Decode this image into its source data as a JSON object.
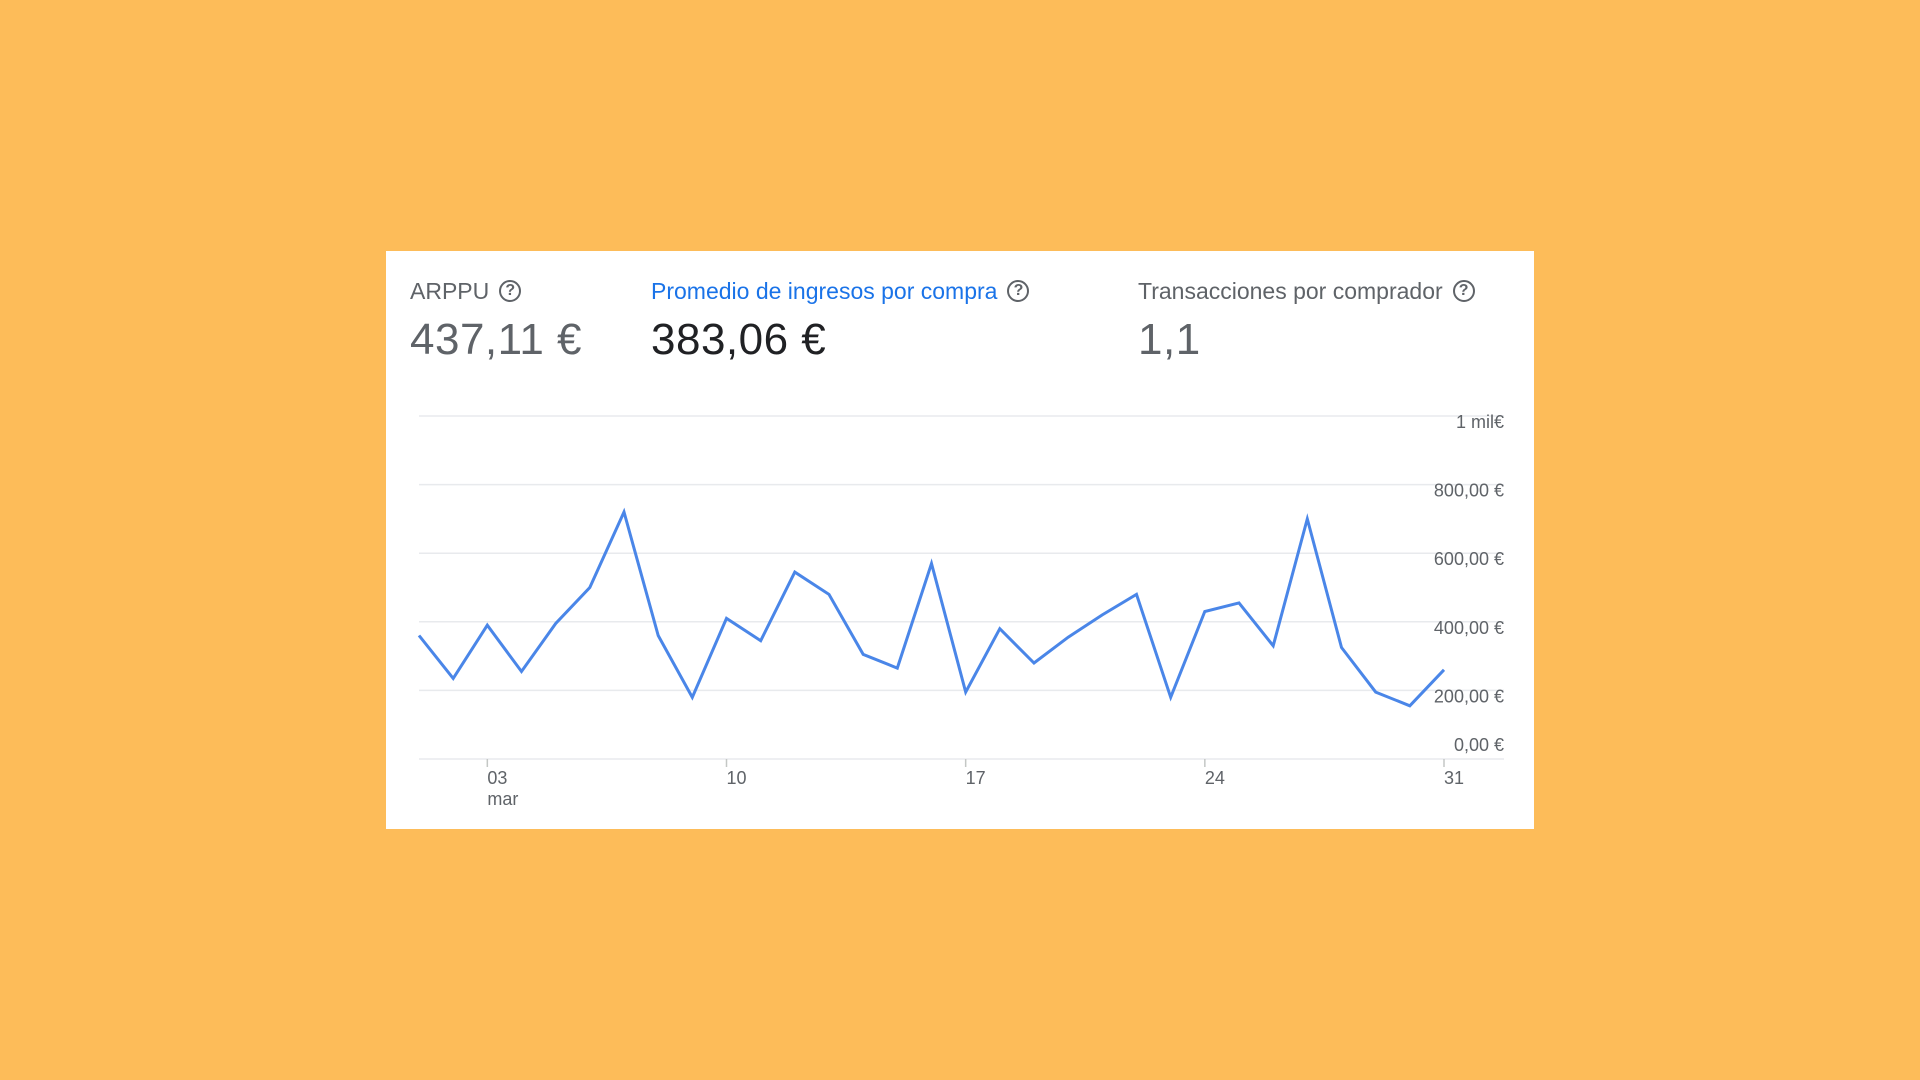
{
  "metrics": [
    {
      "label": "ARPPU",
      "value": "437,11 €",
      "active": false
    },
    {
      "label": "Promedio de ingresos por compra",
      "value": "383,06 €",
      "active": true
    },
    {
      "label": "Transacciones por comprador",
      "value": "1,1",
      "active": false
    }
  ],
  "help_icon": "help-circle-icon",
  "help_glyph": "?",
  "colors": {
    "background": "#FDBC59",
    "line": "#4A86E8",
    "active_label": "#1a73e8",
    "grid": "#e8eaed"
  },
  "chart_data": {
    "type": "line",
    "title": "",
    "xlabel": "",
    "ylabel": "",
    "ylim": [
      0,
      1000
    ],
    "yticks": [
      {
        "value": 1000,
        "label": "1 mil€"
      },
      {
        "value": 800,
        "label": "800,00 €"
      },
      {
        "value": 600,
        "label": "600,00 €"
      },
      {
        "value": 400,
        "label": "400,00 €"
      },
      {
        "value": 200,
        "label": "200,00 €"
      },
      {
        "value": 0,
        "label": "0,00 €"
      }
    ],
    "xticks": [
      {
        "day": 3,
        "label": "03",
        "sublabel": "mar"
      },
      {
        "day": 10,
        "label": "10",
        "sublabel": ""
      },
      {
        "day": 17,
        "label": "17",
        "sublabel": ""
      },
      {
        "day": 24,
        "label": "24",
        "sublabel": ""
      },
      {
        "day": 31,
        "label": "31",
        "sublabel": ""
      }
    ],
    "grid": true,
    "series": [
      {
        "x": [
          1,
          2,
          3,
          4,
          5,
          6,
          7,
          8,
          9,
          10,
          11,
          12,
          13,
          14,
          15,
          16,
          17,
          18,
          19,
          20,
          21,
          22,
          23,
          24,
          25,
          26,
          27,
          28,
          29,
          30,
          31
        ],
        "values": [
          360,
          235,
          390,
          255,
          395,
          500,
          720,
          360,
          180,
          410,
          345,
          545,
          480,
          305,
          265,
          570,
          195,
          380,
          280,
          355,
          420,
          480,
          180,
          430,
          455,
          330,
          700,
          325,
          195,
          155,
          260
        ]
      }
    ]
  }
}
